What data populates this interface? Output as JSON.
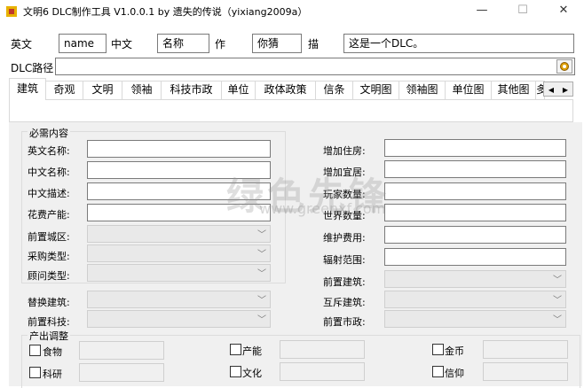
{
  "window": {
    "title": "文明6 DLC制作工具 V1.0.0.1 by 遗失的传说（yixiang2009a）",
    "min_glyph": "—",
    "max_glyph": "☐",
    "close_glyph": "✕"
  },
  "header": {
    "en_label": "英文",
    "en_value": "name",
    "zh_label": "中文",
    "zh_value": "名称",
    "author_label": "作",
    "author_value": "你猜",
    "desc_label": "描",
    "desc_value": "这是一个DLC。",
    "path_label": "DLC路径",
    "path_value": ""
  },
  "tabs": [
    "建筑",
    "奇观",
    "文明",
    "领袖",
    "科技市政",
    "单位",
    "政体政策",
    "信条",
    "文明图",
    "领袖图",
    "单位图",
    "其他图",
    "多"
  ],
  "tab_scroll": {
    "left": "◀",
    "right": "▶"
  },
  "required_group": {
    "title": "必需内容",
    "fields": [
      "英文名称:",
      "中文名称:",
      "中文描述:",
      "花费产能:"
    ],
    "combos": [
      "前置城区:",
      "采购类型:",
      "顾问类型:"
    ]
  },
  "left_extra": [
    "替换建筑:",
    "前置科技:"
  ],
  "right_fields": [
    "增加住房:",
    "增加宜居:",
    "玩家数量:",
    "世界数量:",
    "维护费用:",
    "辐射范围:"
  ],
  "right_combos": [
    "前置建筑:",
    "互斥建筑:",
    "前置市政:"
  ],
  "output_group": {
    "title": "产出调整",
    "items": [
      "食物",
      "产能",
      "金币",
      "科研",
      "文化",
      "信仰"
    ]
  },
  "watermark": {
    "text": "绿色先锋",
    "url": "www.greenxf.com"
  }
}
